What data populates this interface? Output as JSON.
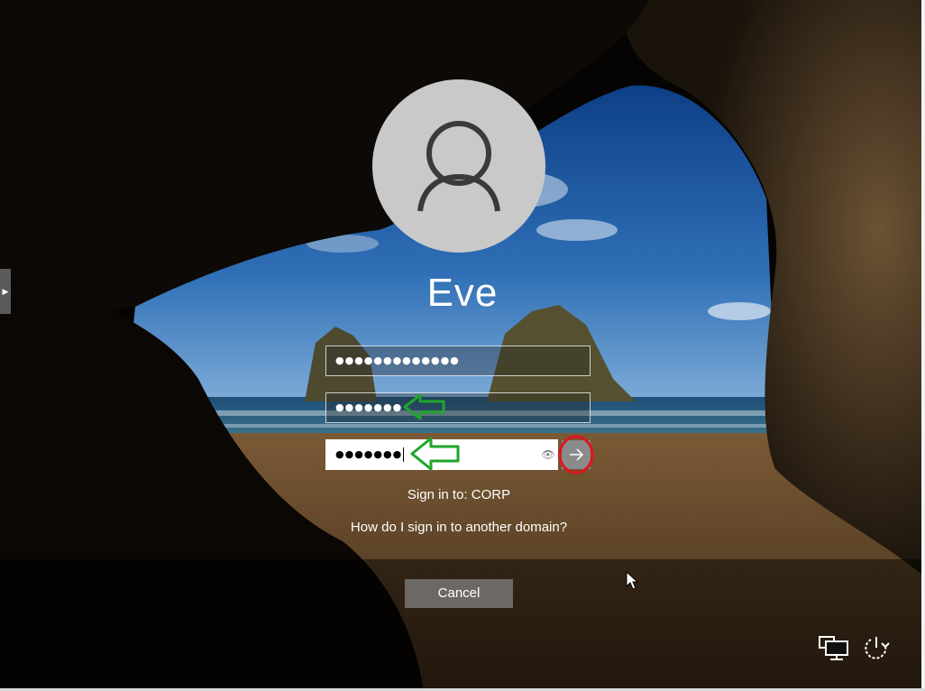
{
  "user": {
    "name": "Eve"
  },
  "fields": {
    "field1_value": "●●●●●●●●●●●●●",
    "field2_value": "●●●●●●●",
    "password_value": "●●●●●●●"
  },
  "signin": {
    "domain_text": "Sign in to: CORP",
    "other_domain_link": "How do I sign in to another domain?",
    "cancel_label": "Cancel"
  },
  "icons": {
    "side_expander": "chevron-right-icon",
    "avatar": "user-icon",
    "reveal": "eye-icon",
    "submit": "arrow-right-icon",
    "network": "network-icon",
    "power": "power-icon"
  },
  "colors": {
    "annotation_arrow": "#1fa52b",
    "annotation_circle": "#e0141c",
    "avatar_bg": "#c9c9c9"
  }
}
